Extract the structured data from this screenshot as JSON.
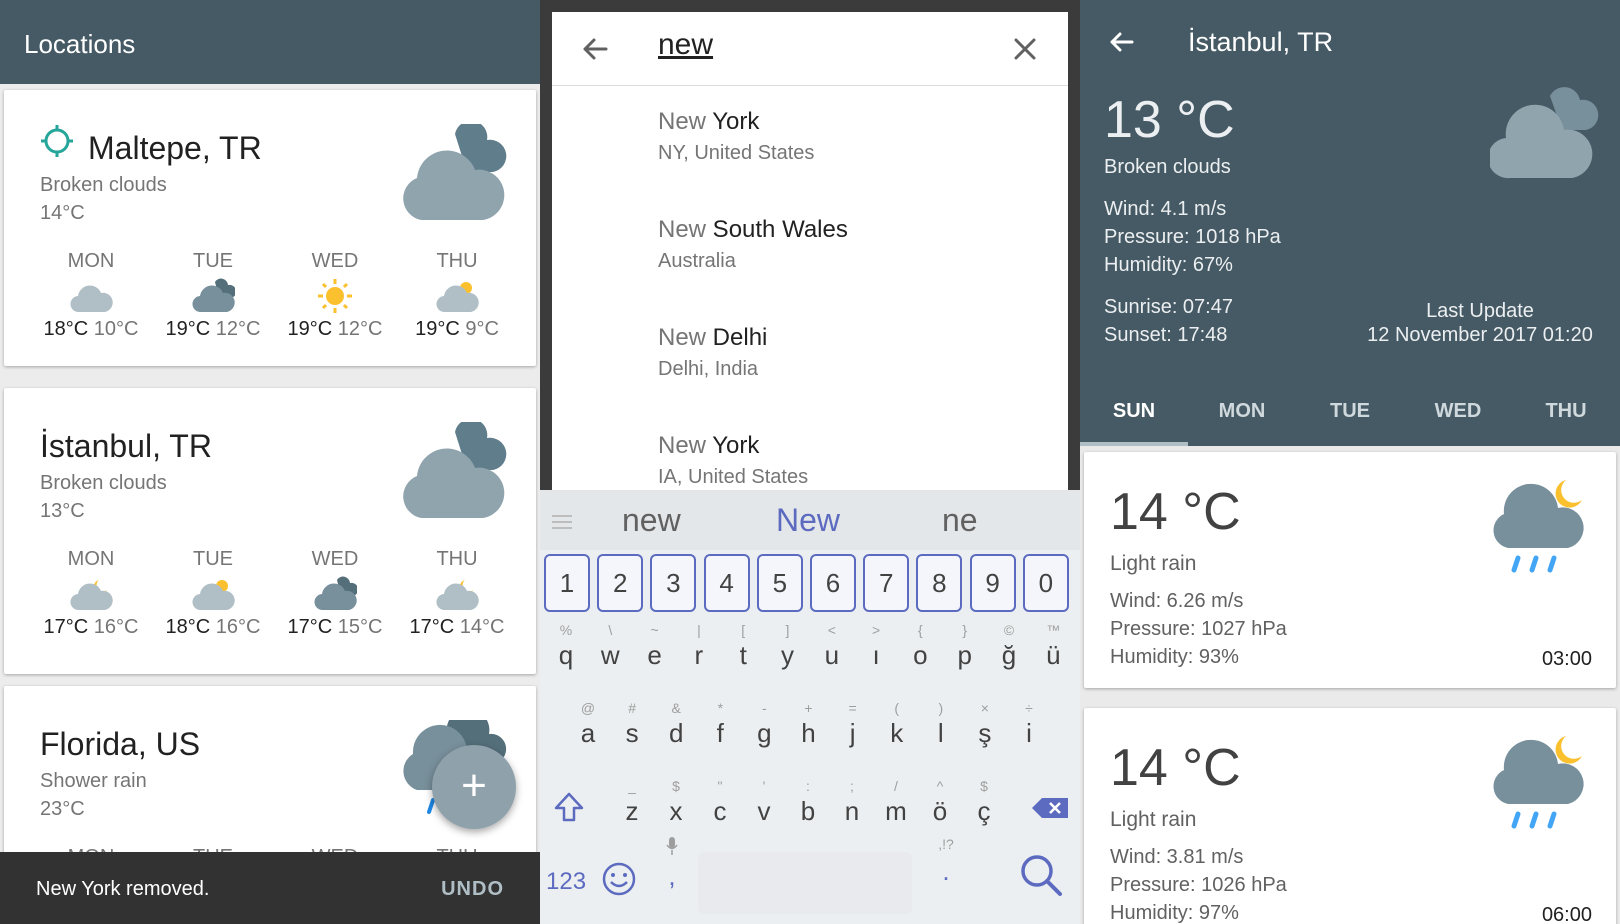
{
  "left": {
    "title": "Locations",
    "cards": [
      {
        "city": "Maltepe, TR",
        "desc": "Broken clouds",
        "temp": "14°C",
        "has_location": true,
        "forecast": [
          {
            "day": "MON",
            "icon": "cloud-light-icon",
            "hi": "18°C",
            "lo": "10°C"
          },
          {
            "day": "TUE",
            "icon": "cloud-dark-icon",
            "hi": "19°C",
            "lo": "12°C"
          },
          {
            "day": "WED",
            "icon": "sun-icon",
            "hi": "19°C",
            "lo": "12°C"
          },
          {
            "day": "THU",
            "icon": "cloud-sun-icon",
            "hi": "19°C",
            "lo": "9°C"
          }
        ]
      },
      {
        "city": "İstanbul, TR",
        "desc": "Broken clouds",
        "temp": "13°C",
        "forecast": [
          {
            "day": "MON",
            "icon": "cloud-moon-icon",
            "hi": "17°C",
            "lo": "16°C"
          },
          {
            "day": "TUE",
            "icon": "cloud-sun-icon",
            "hi": "18°C",
            "lo": "16°C"
          },
          {
            "day": "WED",
            "icon": "cloud-dark-icon",
            "hi": "17°C",
            "lo": "15°C"
          },
          {
            "day": "THU",
            "icon": "cloud-moon-icon",
            "hi": "17°C",
            "lo": "14°C"
          }
        ]
      },
      {
        "city": "Florida, US",
        "desc": "Shower rain",
        "temp": "23°C",
        "forecast": [
          {
            "day": "MON"
          },
          {
            "day": "TUE"
          },
          {
            "day": "WED"
          },
          {
            "day": "THU"
          }
        ]
      }
    ],
    "fab": "+",
    "snackbar": {
      "message": "New York removed.",
      "action": "UNDO"
    }
  },
  "search": {
    "query": "new",
    "results": [
      {
        "prefix": "New",
        "rest": " York",
        "sub": "NY, United States"
      },
      {
        "prefix": "New",
        "rest": " South Wales",
        "sub": "Australia"
      },
      {
        "prefix": "New",
        "rest": " Delhi",
        "sub": "Delhi, India"
      },
      {
        "prefix": "New",
        "rest": " York",
        "sub": "IA, United States"
      }
    ],
    "suggestions": [
      "new",
      "New",
      "ne"
    ],
    "numbers": [
      "1",
      "2",
      "3",
      "4",
      "5",
      "6",
      "7",
      "8",
      "9",
      "0"
    ],
    "row1": [
      {
        "h": "%",
        "l": "q"
      },
      {
        "h": "\\",
        "l": "w"
      },
      {
        "h": "~",
        "l": "e"
      },
      {
        "h": "|",
        "l": "r"
      },
      {
        "h": "[",
        "l": "t"
      },
      {
        "h": "]",
        "l": "y"
      },
      {
        "h": "<",
        "l": "u"
      },
      {
        "h": ">",
        "l": "ı"
      },
      {
        "h": "{",
        "l": "o"
      },
      {
        "h": "}",
        "l": "p"
      },
      {
        "h": "©",
        "l": "ğ"
      },
      {
        "h": "™",
        "l": "ü"
      }
    ],
    "row2": [
      {
        "h": "@",
        "l": "a"
      },
      {
        "h": "#",
        "l": "s"
      },
      {
        "h": "&",
        "l": "d"
      },
      {
        "h": "*",
        "l": "f"
      },
      {
        "h": "-",
        "l": "g"
      },
      {
        "h": "+",
        "l": "h"
      },
      {
        "h": "=",
        "l": "j"
      },
      {
        "h": "(",
        "l": "k"
      },
      {
        "h": ")",
        "l": "l"
      },
      {
        "h": "×",
        "l": "ş"
      },
      {
        "h": "÷",
        "l": "i"
      }
    ],
    "row3": [
      {
        "h": "_",
        "l": "z"
      },
      {
        "h": "$",
        "l": "x"
      },
      {
        "h": "\"",
        "l": "c"
      },
      {
        "h": "'",
        "l": "v"
      },
      {
        "h": ":",
        "l": "b"
      },
      {
        "h": ";",
        "l": "n"
      },
      {
        "h": "/",
        "l": "m"
      },
      {
        "h": "^",
        "l": "ö"
      },
      {
        "h": "$",
        "l": "ç"
      }
    ],
    "sym_label": "123",
    "comma": ",",
    "period": ".",
    "period_hint": ",!?"
  },
  "detail": {
    "title": "İstanbul, TR",
    "temp": "13 °C",
    "desc": "Broken clouds",
    "wind": "Wind: 4.1 m/s",
    "pressure": "Pressure: 1018 hPa",
    "humidity": "Humidity: 67%",
    "sunrise": "Sunrise: 07:47",
    "sunset": "Sunset: 17:48",
    "last_update_label": "Last Update",
    "last_update": "12 November 2017 01:20",
    "tabs": [
      "SUN",
      "MON",
      "TUE",
      "WED",
      "THU"
    ],
    "hours": [
      {
        "temp": "14 °C",
        "desc": "Light rain",
        "wind": "Wind: 6.26 m/s",
        "pressure": "Pressure: 1027 hPa",
        "humidity": "Humidity: 93%",
        "time": "03:00"
      },
      {
        "temp": "14 °C",
        "desc": "Light rain",
        "wind": "Wind: 3.81 m/s",
        "pressure": "Pressure: 1026 hPa",
        "humidity": "Humidity: 97%",
        "time": "06:00"
      }
    ]
  },
  "colors": {
    "appbar": "#455a64",
    "accent": "#5c6bc0",
    "location_icon": "#26a69a",
    "cloud": "#90a4ae",
    "sun": "#fbc02d",
    "fab": "#8fa2ac"
  }
}
